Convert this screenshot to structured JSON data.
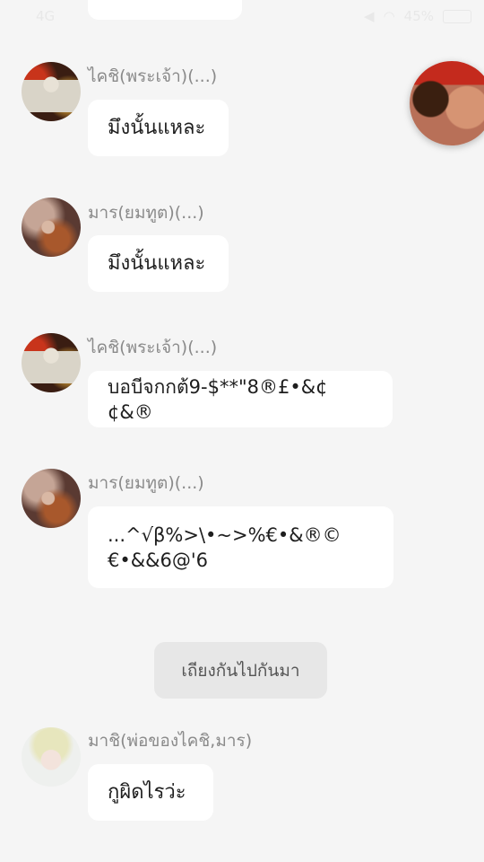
{
  "status_bar": {
    "network": "4G",
    "battery": "45%"
  },
  "float_bubble": {
    "icon": "video-call-bubble"
  },
  "messages": [
    {
      "sender": "ไคชิ(พระเจ้า)(...)",
      "text": "มึงนั้นแหละ",
      "avatar": "kai"
    },
    {
      "sender": "มาร(ยมทูต)(...)",
      "text": "มึงนั้นแหละ",
      "avatar": "mara"
    },
    {
      "sender": "ไคชิ(พระเจ้า)(...)",
      "text": "บอบีจกกต้9-$**\"8®£•&¢¢&®",
      "avatar": "kai"
    },
    {
      "sender": "มาร(ยมทูต)(...)",
      "text": "...^√β%>\\•~>%€•&®©\n€•&&6@'6",
      "avatar": "mara"
    },
    {
      "sender": "มาชิ(พ่อของไคชิ,มาร)",
      "text": "กูผิดไรว่ะ",
      "avatar": "machi"
    }
  ],
  "notice": "เถียงกันไปกันมา"
}
